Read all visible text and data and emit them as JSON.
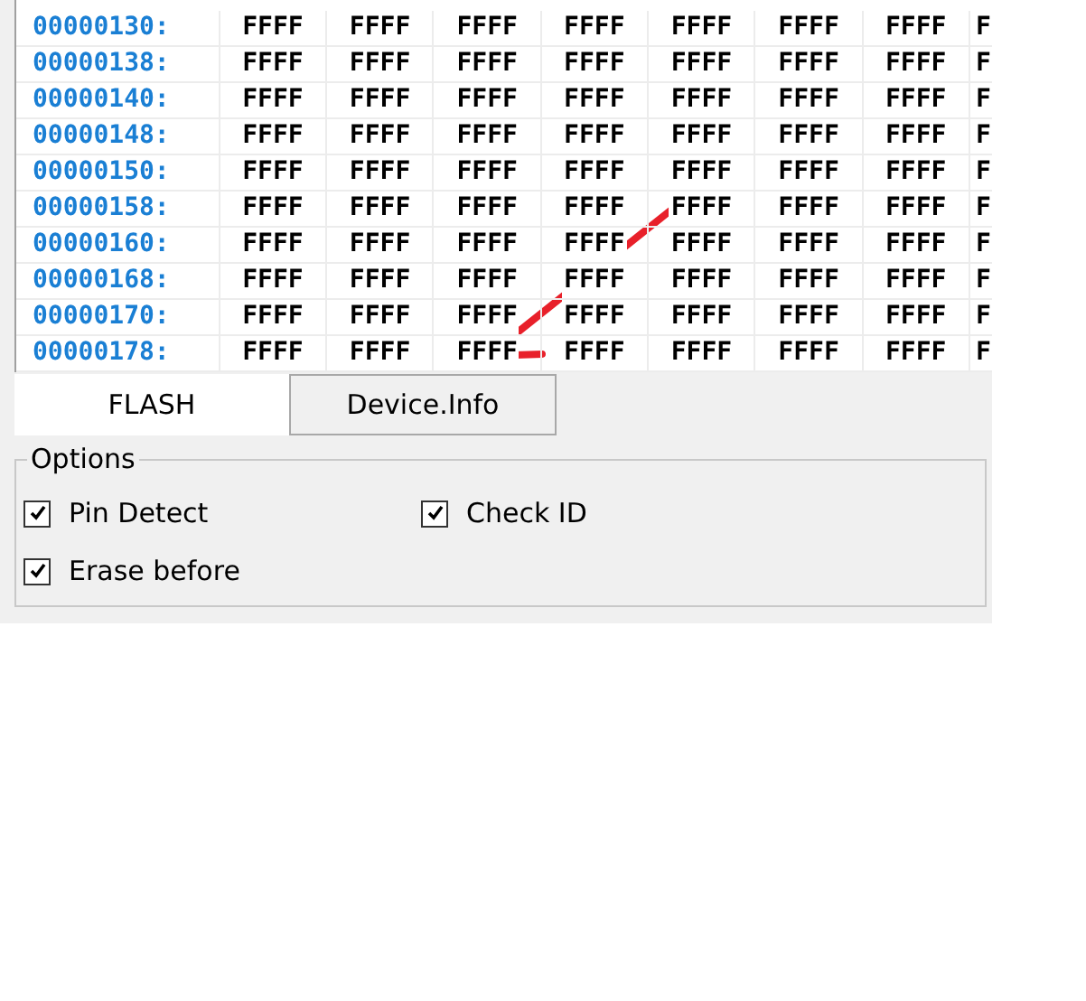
{
  "hex_table": {
    "rows": [
      {
        "address": "00000130:",
        "cells": [
          "FFFF",
          "FFFF",
          "FFFF",
          "FFFF",
          "FFFF",
          "FFFF",
          "FFFF",
          "F"
        ]
      },
      {
        "address": "00000138:",
        "cells": [
          "FFFF",
          "FFFF",
          "FFFF",
          "FFFF",
          "FFFF",
          "FFFF",
          "FFFF",
          "F"
        ]
      },
      {
        "address": "00000140:",
        "cells": [
          "FFFF",
          "FFFF",
          "FFFF",
          "FFFF",
          "FFFF",
          "FFFF",
          "FFFF",
          "F"
        ]
      },
      {
        "address": "00000148:",
        "cells": [
          "FFFF",
          "FFFF",
          "FFFF",
          "FFFF",
          "FFFF",
          "FFFF",
          "FFFF",
          "F"
        ]
      },
      {
        "address": "00000150:",
        "cells": [
          "FFFF",
          "FFFF",
          "FFFF",
          "FFFF",
          "FFFF",
          "FFFF",
          "FFFF",
          "F"
        ]
      },
      {
        "address": "00000158:",
        "cells": [
          "FFFF",
          "FFFF",
          "FFFF",
          "FFFF",
          "FFFF",
          "FFFF",
          "FFFF",
          "F"
        ]
      },
      {
        "address": "00000160:",
        "cells": [
          "FFFF",
          "FFFF",
          "FFFF",
          "FFFF",
          "FFFF",
          "FFFF",
          "FFFF",
          "F"
        ]
      },
      {
        "address": "00000168:",
        "cells": [
          "FFFF",
          "FFFF",
          "FFFF",
          "FFFF",
          "FFFF",
          "FFFF",
          "FFFF",
          "F"
        ]
      },
      {
        "address": "00000170:",
        "cells": [
          "FFFF",
          "FFFF",
          "FFFF",
          "FFFF",
          "FFFF",
          "FFFF",
          "FFFF",
          "F"
        ]
      },
      {
        "address": "00000178:",
        "cells": [
          "FFFF",
          "FFFF",
          "FFFF",
          "FFFF",
          "FFFF",
          "FFFF",
          "FFFF",
          "F"
        ]
      }
    ]
  },
  "tabs": [
    {
      "label": "FLASH",
      "selected": true
    },
    {
      "label": "Device.Info",
      "selected": false
    }
  ],
  "options": {
    "title": "Options",
    "checkboxes": [
      {
        "label": "Pin Detect",
        "checked": true
      },
      {
        "label": "Check ID",
        "checked": true
      },
      {
        "label": "Erase before",
        "checked": true
      }
    ]
  }
}
